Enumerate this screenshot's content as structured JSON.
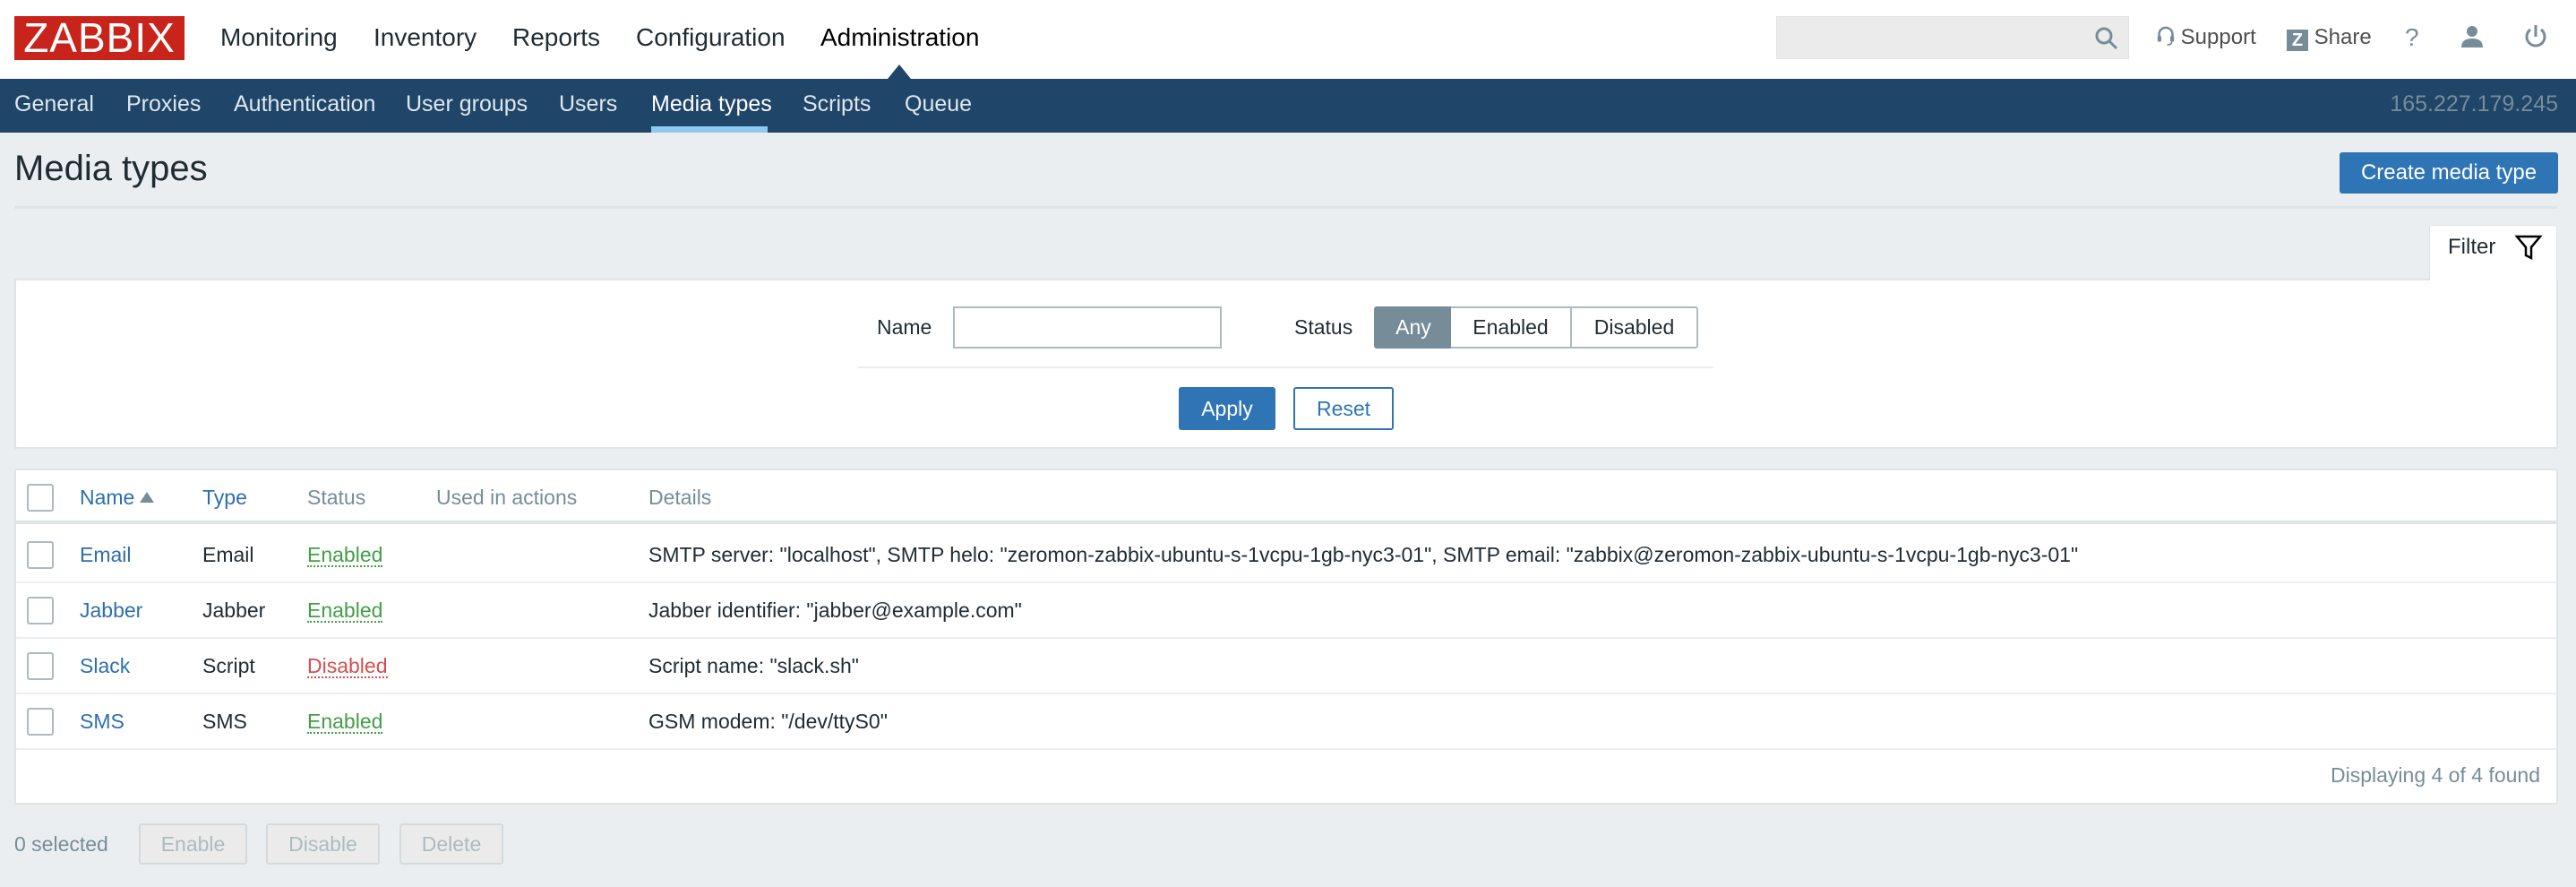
{
  "header": {
    "logo": "ZABBIX",
    "main_menu": [
      {
        "label": "Monitoring",
        "active": false
      },
      {
        "label": "Inventory",
        "active": false
      },
      {
        "label": "Reports",
        "active": false
      },
      {
        "label": "Configuration",
        "active": false
      },
      {
        "label": "Administration",
        "active": true
      }
    ],
    "search": {
      "value": "",
      "placeholder": ""
    },
    "support_label": "Support",
    "share_label": "Share",
    "help_label": "?",
    "share_badge": "Z"
  },
  "subnav": {
    "items": [
      {
        "label": "General"
      },
      {
        "label": "Proxies"
      },
      {
        "label": "Authentication"
      },
      {
        "label": "User groups"
      },
      {
        "label": "Users"
      },
      {
        "label": "Media types",
        "active": true
      },
      {
        "label": "Scripts"
      },
      {
        "label": "Queue"
      }
    ],
    "server_ip": "165.227.179.245"
  },
  "page": {
    "title": "Media types",
    "create_button": "Create media type"
  },
  "filter": {
    "tab_label": "Filter",
    "name_label": "Name",
    "name_value": "",
    "status_label": "Status",
    "status_options": [
      "Any",
      "Enabled",
      "Disabled"
    ],
    "status_selected": "Any",
    "apply_label": "Apply",
    "reset_label": "Reset"
  },
  "table": {
    "columns": [
      "Name",
      "Type",
      "Status",
      "Used in actions",
      "Details"
    ],
    "sort_column": "Name",
    "sort_direction": "asc",
    "rows": [
      {
        "name": "Email",
        "type": "Email",
        "status": "Enabled",
        "used_in_actions": "",
        "details": "SMTP server: \"localhost\", SMTP helo: \"zeromon-zabbix-ubuntu-s-1vcpu-1gb-nyc3-01\", SMTP email: \"zabbix@zeromon-zabbix-ubuntu-s-1vcpu-1gb-nyc3-01\""
      },
      {
        "name": "Jabber",
        "type": "Jabber",
        "status": "Enabled",
        "used_in_actions": "",
        "details": "Jabber identifier: \"jabber@example.com\""
      },
      {
        "name": "Slack",
        "type": "Script",
        "status": "Disabled",
        "used_in_actions": "",
        "details": "Script name: \"slack.sh\""
      },
      {
        "name": "SMS",
        "type": "SMS",
        "status": "Enabled",
        "used_in_actions": "",
        "details": "GSM modem: \"/dev/ttyS0\""
      }
    ],
    "footer": "Displaying 4 of 4 found"
  },
  "actions": {
    "selected_count": "0 selected",
    "enable_label": "Enable",
    "disable_label": "Disable",
    "delete_label": "Delete"
  },
  "colors": {
    "brand_red": "#c8241b",
    "nav_blue": "#1f4568",
    "primary_blue": "#2f75b5",
    "enabled_green": "#429e47",
    "disabled_red": "#d64e4e"
  }
}
